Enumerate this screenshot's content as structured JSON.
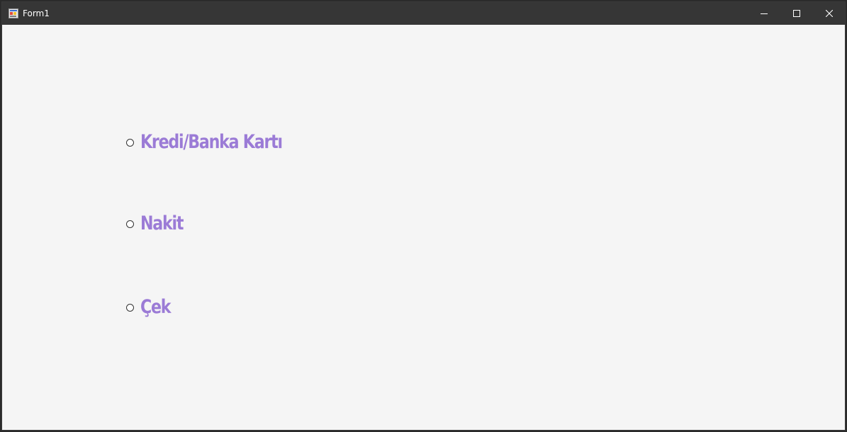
{
  "window": {
    "title": "Form1"
  },
  "title_controls": {
    "minimize_icon": "minimize-icon",
    "maximize_icon": "maximize-icon",
    "close_icon": "close-icon"
  },
  "payment_options": [
    {
      "label": "Kredi/Banka Kartı",
      "selected": false
    },
    {
      "label": "Nakit",
      "selected": false
    },
    {
      "label": "Çek",
      "selected": false
    }
  ],
  "colors": {
    "label_color": "#9b7bd6",
    "titlebar_bg": "#363636",
    "client_bg": "#f5f5f5"
  }
}
